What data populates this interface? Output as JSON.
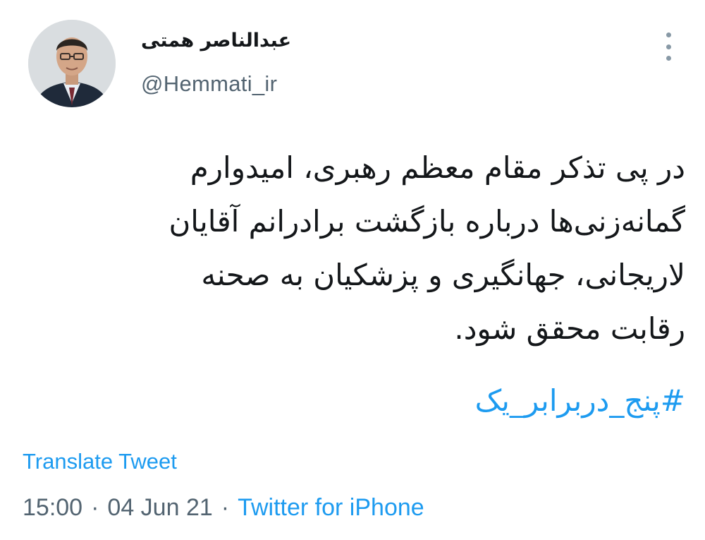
{
  "author": {
    "display_name": "عبدالناصر همتی",
    "handle": "@Hemmati_ir",
    "avatar_icon": "profile-photo"
  },
  "more_icon": "vertical-dots-icon",
  "tweet": {
    "lines": [
      "در پی تذکر مقام معظم رهبری، امیدوارم",
      "گمانه‌زنی‌ها درباره بازگشت برادرانم آقایان",
      "لاریجانی، جهانگیری و پزشکیان به صحنه",
      "رقابت محقق شود."
    ],
    "hashtag": "#پنج_دربرابر_یک"
  },
  "translate_label": "Translate Tweet",
  "meta": {
    "time": "15:00",
    "separator": "·",
    "date": "04 Jun 21",
    "source": "Twitter for iPhone"
  },
  "colors": {
    "link": "#1d9bf0",
    "text": "#14171a",
    "secondary": "#536471"
  }
}
